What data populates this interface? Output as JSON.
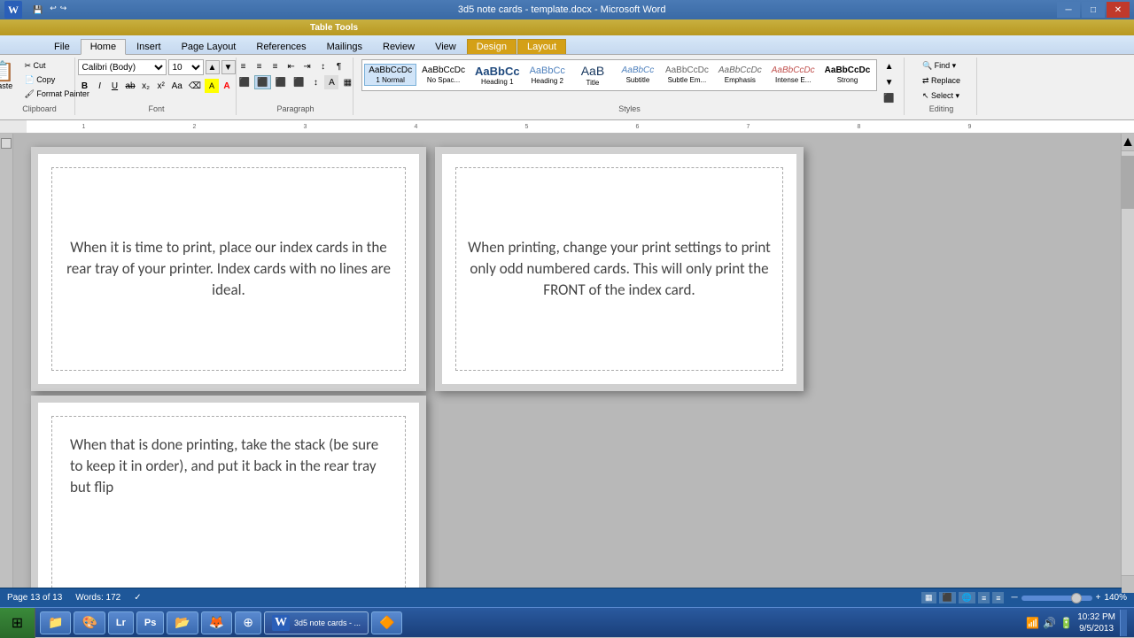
{
  "window": {
    "title": "3d5 note cards - template.docx - Microsoft Word",
    "table_tools_label": "Table Tools"
  },
  "ribbon_tabs": {
    "file": "File",
    "home": "Home",
    "insert": "Insert",
    "page_layout": "Page Layout",
    "references": "References",
    "mailings": "Mailings",
    "review": "Review",
    "view": "View",
    "design": "Design",
    "layout": "Layout"
  },
  "clipboard": {
    "paste": "Paste",
    "cut": "Cut",
    "copy": "Copy",
    "format_painter": "Format Painter",
    "group_label": "Clipboard"
  },
  "font": {
    "name": "Calibri (Body)",
    "size": "10",
    "bold": "B",
    "italic": "I",
    "underline": "U",
    "strikethrough": "ab",
    "subscript": "x₂",
    "superscript": "x²",
    "text_highlight": "A",
    "font_color": "A",
    "grow": "A",
    "shrink": "A",
    "clear": "⌫",
    "case": "Aa",
    "group_label": "Font"
  },
  "styles": [
    {
      "label": "1 Normal",
      "preview": "AaBbCcDc"
    },
    {
      "label": "No Spac...",
      "preview": "AaBbCcDc"
    },
    {
      "label": "Heading 1",
      "preview": "AaBbCc"
    },
    {
      "label": "Heading 2",
      "preview": "AaBbCc"
    },
    {
      "label": "Title",
      "preview": "AaB"
    },
    {
      "label": "Subtitle",
      "preview": "AaBbCc"
    },
    {
      "label": "Subtle Em...",
      "preview": "AaBbCcDc"
    },
    {
      "label": "Emphasis",
      "preview": "AaBbCcDc"
    }
  ],
  "cards": {
    "card1_text": "When it is time to print, place our index cards in the rear tray of your printer.  Index cards with no lines are ideal.",
    "card2_text": "When printing, change your print settings to print only odd numbered cards.  This will only print the FRONT of the index card.",
    "card3_text": "When that is done printing, take the stack (be sure to keep it in order), and put it back in the rear tray but flip"
  },
  "status_bar": {
    "page": "Page 13 of 13",
    "words": "Words: 172",
    "spell_check": "✓",
    "zoom": "140%",
    "zoom_level": 140
  },
  "taskbar": {
    "start_icon": "⊞",
    "apps": [
      {
        "label": "File Explorer",
        "icon": "📁"
      },
      {
        "label": "Paint",
        "icon": "🎨"
      },
      {
        "label": "Lightroom",
        "icon": "Lr"
      },
      {
        "label": "Photoshop",
        "icon": "Ps"
      },
      {
        "label": "Explorer",
        "icon": "📂"
      },
      {
        "label": "Firefox",
        "icon": "🦊"
      },
      {
        "label": "Chrome",
        "icon": "●"
      },
      {
        "label": "Microsoft Word",
        "icon": "W",
        "active": true
      }
    ],
    "clock_time": "10:32 PM",
    "clock_date": "9/5/2013"
  },
  "paragraph": {
    "align_left": "≡",
    "align_center": "≡",
    "align_right": "≡",
    "justify": "≡",
    "line_spacing": "≡",
    "shading": "▢",
    "borders": "▦",
    "group_label": "Paragraph"
  }
}
